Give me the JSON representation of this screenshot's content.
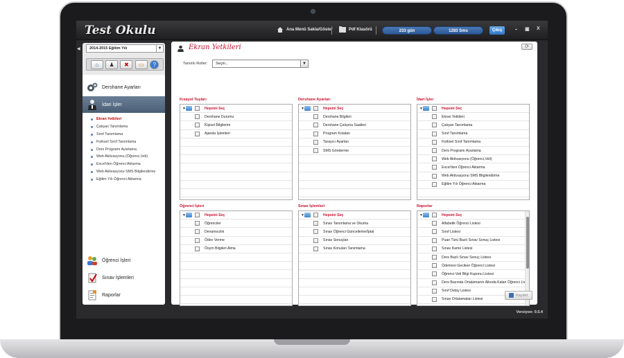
{
  "app": {
    "title": "Test Okulu",
    "version": "Versiyon: 0.5.4"
  },
  "topbar": {
    "home_label": "Ana Menü Sakla/Göster",
    "pdf_label": "Pdf Klasörü",
    "days_left": "233 gün",
    "sms_count": "1283 Sms",
    "exit_label": "Çıkış",
    "minimize": "-",
    "restore": "▣",
    "close": "X"
  },
  "sidebar": {
    "year_select": "2014-2015 Eğitim Yılı",
    "year_arrow": "▼",
    "collapse_arrow": "◀",
    "toolbar": [
      {
        "name": "home-icon",
        "glyph": "⌂"
      },
      {
        "name": "user-icon",
        "glyph": "♟"
      },
      {
        "name": "delete-icon",
        "glyph": "✖"
      },
      {
        "name": "calendar-icon",
        "glyph": "▭"
      },
      {
        "name": "help-icon",
        "glyph": "?"
      }
    ],
    "sections": [
      {
        "label": "Dershane Ayarları"
      },
      {
        "label": "İdari İşler"
      },
      {
        "label": "Öğrenci İşleri"
      },
      {
        "label": "Sınav İşlemleri"
      },
      {
        "label": "Raporlar"
      }
    ],
    "sub_items": [
      "Ekran Yetkileri",
      "Çalışan Tanımlama",
      "Sınıf Tanımlama",
      "Fiziksel Sınıf Tanımlama",
      "Ders Programı Ayarlama",
      "Web Aktivasyonu (Öğrenci,Veli)",
      "Excel'den Öğrenci Aktarma",
      "Web Aktivasyonu SMS Bilgilendirme",
      "Eğitim Yılı Öğrenci Aktarma"
    ]
  },
  "main": {
    "page_title": "Ekran Yetkileri",
    "refresh": "⟳",
    "roles_label": "Tanımlı Roller:",
    "roles_value": "Seçin...",
    "roles_arrow": "▼",
    "select_all": "Hepsini Seç",
    "save_label": "Kaydet",
    "groups": [
      {
        "title": "Kısayol Tuşları",
        "items": [
          "Dershane Durumu",
          "Kişisel Bilgilerim",
          "Ajanda İşlemleri"
        ]
      },
      {
        "title": "Dershane Ayarları",
        "items": [
          "Dershane Bilgileri",
          "Dershane Çalışma Saatleri",
          "Program Kotaları",
          "Tarayıcı Ayarları",
          "SMS Gönderme"
        ]
      },
      {
        "title": "İdari İşler",
        "items": [
          "Ekran Yetkileri",
          "Çalışan Tanımlama",
          "Sınıf Tanımlama",
          "Fiziksel Sınıf Tanımlama",
          "Ders Programı Ayarlama",
          "Web Aktivasyonu (Öğrenci,Veli)",
          "Excel'den Öğrenci Aktarma",
          "Web Aktivasyonu SMS Bilgilendirme",
          "Eğitim Yılı Öğrenci Aktarma"
        ]
      },
      {
        "title": "Öğrenci İşleri",
        "items": [
          "Öğrenciler",
          "Devamsızlık",
          "Ödev Verme",
          "Ösym Bilgileri Alma"
        ]
      },
      {
        "title": "Sınav İşlemleri",
        "items": [
          "Sınav Tanımlama ve Okuma",
          "Sınav Öğrenci Güncelleme/İptal",
          "Sınav Sonuçları",
          "Sınav Konuları Tanımlama"
        ]
      },
      {
        "title": "Raporlar",
        "items": [
          "Alfabetik Öğrenci Listesi",
          "Sınıf Listesi",
          "Puan Türü Bazlı Sınav Sonuç Listesi",
          "Sınav Kame Listesi",
          "Ders Bazlı Sınav Sonuç Listesi",
          "Ödemesi Geciken Öğrenci Listesi",
          "Öğrenci-Veli Bilgi Kuponu Listesi",
          "Ders Bazında Ortalamanın Altında Kalan Öğrenci Lis",
          "Sınıf Detay Listesi",
          "Sınav Ortalamaları Listesi"
        ]
      }
    ]
  },
  "colors": {
    "accent_red": "#c8102e",
    "pill_blue": "#2c5a98",
    "active_menu": "#4b5f76"
  }
}
